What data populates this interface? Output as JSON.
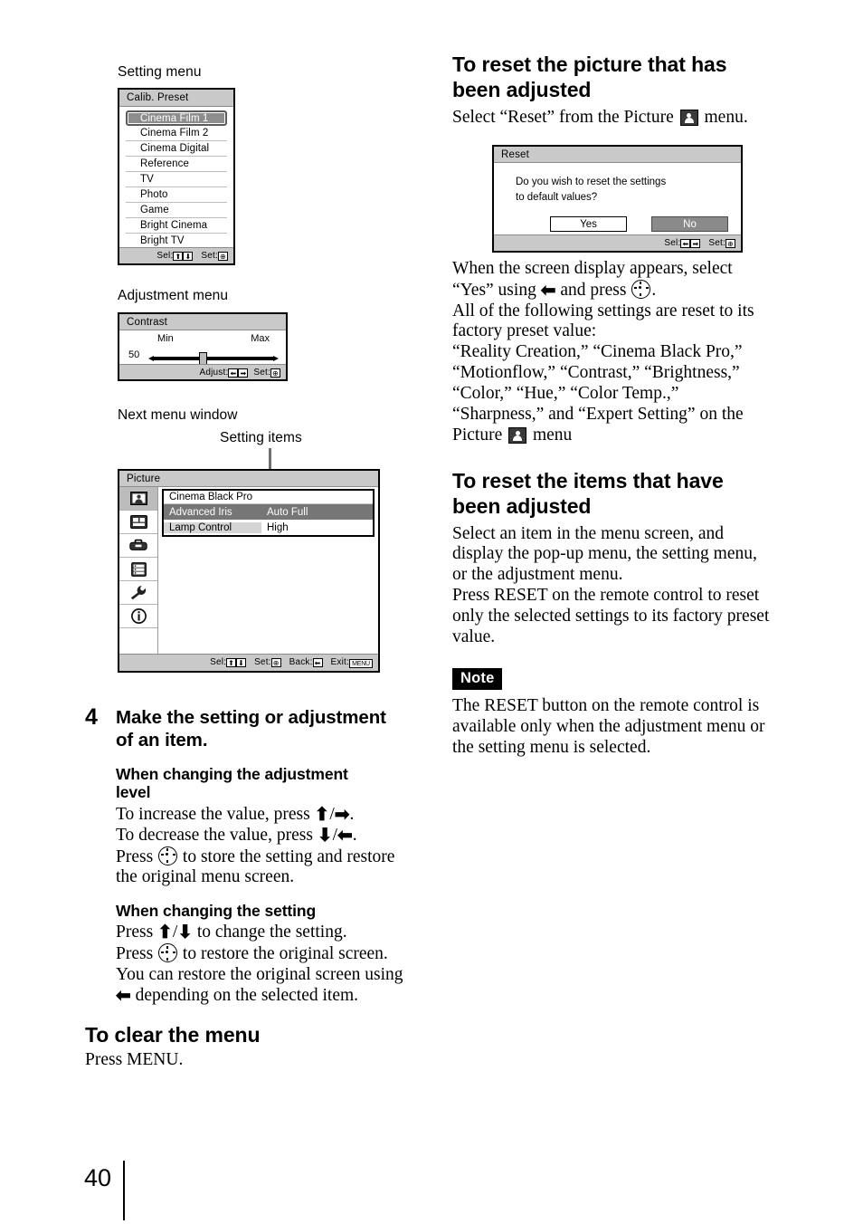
{
  "page": {
    "number": "40"
  },
  "left_column": {
    "caption_setting_menu": "Setting menu",
    "caption_adjustment_menu": "Adjustment menu",
    "caption_next_menu_window": "Next menu window",
    "caption_setting_items": "Setting items",
    "calib_menu": {
      "title": "Calib. Preset",
      "items": [
        "Cinema Film 1",
        "Cinema Film 2",
        "Cinema Digital",
        "Reference",
        "TV",
        "Photo",
        "Game",
        "Bright Cinema",
        "Bright TV"
      ],
      "selected_index": 0,
      "footer": {
        "sel_label": "Sel:",
        "set_label": "Set:",
        "up_key": "⬆",
        "down_key": "⬇",
        "enter_key": "⊕"
      }
    },
    "contrast_menu": {
      "title": "Contrast",
      "min_label": "Min",
      "max_label": "Max",
      "value": "50",
      "footer": {
        "adjust_label": "Adjust:",
        "set_label": "Set:",
        "left_key": "⬅",
        "right_key": "➡",
        "enter_key": "⊕"
      }
    },
    "picture_menu": {
      "title": "Picture",
      "sidebar_icons": [
        "picture-icon",
        "screen-icon",
        "toolbox-icon",
        "function-list-icon",
        "installation-wrench-icon",
        "information-icon"
      ],
      "active_icon_index": 0,
      "rows": [
        {
          "label": "Cinema Black Pro",
          "value": "",
          "state": "header"
        },
        {
          "label": "Advanced Iris",
          "value": "Auto Full",
          "state": "selected"
        },
        {
          "label": "Lamp Control",
          "value": "High",
          "state": "normal"
        }
      ],
      "footer": {
        "sel_label": "Sel:",
        "set_label": "Set:",
        "back_label": "Back:",
        "exit_label": "Exit:",
        "up_key": "⬆",
        "down_key": "⬇",
        "enter_key": "⊕",
        "back_key": "⬅",
        "menu_key": "MENU"
      }
    },
    "step4": {
      "number": "4",
      "title_line1": "Make the setting or adjustment",
      "title_line2": "of an item.",
      "sub1_line1": "When changing the adjustment",
      "sub1_line2": "level",
      "sub1_p1_pre": "To increase the value, press ",
      "sub1_p1_up": "⬆",
      "sub1_p1_slash": "/",
      "sub1_p1_right": "➡",
      "sub1_p1_post": ".",
      "sub1_p2_pre": "To decrease the value, press ",
      "sub1_p2_down": "⬇",
      "sub1_p2_slash": "/",
      "sub1_p2_left": "⬅",
      "sub1_p2_post": ".",
      "sub1_p3_pre": "Press ",
      "sub1_p3_post": " to store the setting and restore",
      "sub1_p4": "the original menu screen.",
      "sub2_title": "When changing the setting",
      "sub2_p1_pre": "Press ",
      "sub2_p1_up": "⬆",
      "sub2_p1_slash": "/",
      "sub2_p1_down": "⬇",
      "sub2_p1_post": " to change the setting.",
      "sub2_p2_pre": "Press ",
      "sub2_p2_post": " to restore the original screen.",
      "sub2_p3": "You can restore the original screen using",
      "sub2_p4_left": "⬅",
      "sub2_p4_post": " depending on the selected item."
    },
    "clear_menu": {
      "heading": "To clear the menu",
      "body": "Press MENU."
    }
  },
  "right_column": {
    "reset_picture": {
      "heading_line1": "To reset the picture that has",
      "heading_line2": "been adjusted",
      "intro_pre": "Select “Reset” from the Picture ",
      "intro_post": " menu."
    },
    "reset_dialog": {
      "title": "Reset",
      "message_line1": "Do you wish to reset the settings",
      "message_line2": "to default values?",
      "buttons": [
        {
          "label": "Yes",
          "state": "normal"
        },
        {
          "label": "No",
          "state": "selected"
        }
      ],
      "footer": {
        "sel_label": "Sel:",
        "set_label": "Set:",
        "left_key": "⬅",
        "right_key": "➡",
        "enter_key": "⊕"
      }
    },
    "reset_picture_body": {
      "l1": "When the screen display appears, select",
      "l2_pre": "“Yes” using ",
      "l2_arrow": "⬅",
      "l2_mid": " and press ",
      "l2_post": ".",
      "l3": "All of the following settings are reset to its",
      "l4": "factory preset value:",
      "l5": "“Reality Creation,” “Cinema Black Pro,”",
      "l6": "“Motionflow,” “Contrast,” “Brightness,”",
      "l7": "“Color,” “Hue,” “Color Temp.,”",
      "l8": "“Sharpness,” and “Expert Setting” on the",
      "l9_pre": "Picture ",
      "l9_post": " menu"
    },
    "reset_items": {
      "heading_line1": "To reset the items that have",
      "heading_line2": "been adjusted",
      "l1": "Select an item in the menu screen, and",
      "l2": "display the pop-up menu, the setting menu,",
      "l3": "or the adjustment menu.",
      "l4": "Press RESET on the remote control to reset",
      "l5": "only the selected settings to its factory preset",
      "l6": "value."
    },
    "note": {
      "badge": "Note",
      "l1": "The RESET button on the remote control is",
      "l2": "available only when the adjustment menu or",
      "l3": "the setting menu is selected."
    }
  }
}
